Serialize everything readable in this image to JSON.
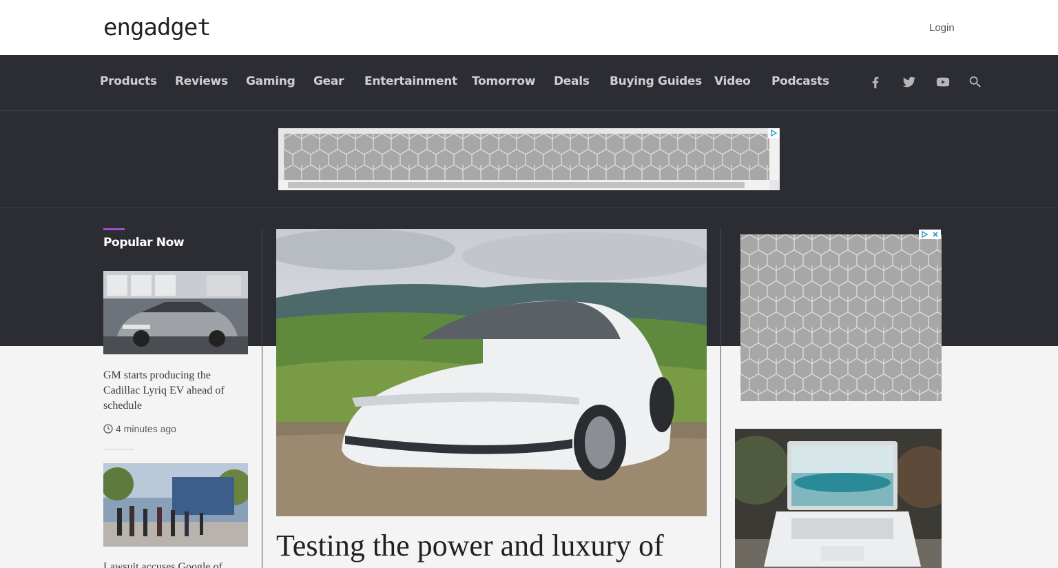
{
  "header": {
    "logo_text": "engadget",
    "login_label": "Login"
  },
  "nav": {
    "items": [
      {
        "label": "Products"
      },
      {
        "label": "Reviews"
      },
      {
        "label": "Gaming"
      },
      {
        "label": "Gear"
      },
      {
        "label": "Entertainment"
      },
      {
        "label": "Tomorrow"
      },
      {
        "label": "Deals"
      },
      {
        "label": "Buying Guides"
      },
      {
        "label": "Video"
      },
      {
        "label": "Podcasts"
      }
    ],
    "social_icons": [
      "facebook-icon",
      "twitter-icon",
      "youtube-icon",
      "search-icon"
    ]
  },
  "popular": {
    "heading": "Popular Now",
    "stories": [
      {
        "title": "GM starts producing the Cadillac Lyriq EV ahead of schedule",
        "time": "4 minutes ago"
      },
      {
        "title": "Lawsuit accuses Google of"
      }
    ]
  },
  "hero": {
    "title": "Testing the power and luxury of"
  },
  "colors": {
    "dark_bg": "#2c2c33",
    "accent": "#9a4fd1",
    "light_bg": "#f4f4f5"
  }
}
